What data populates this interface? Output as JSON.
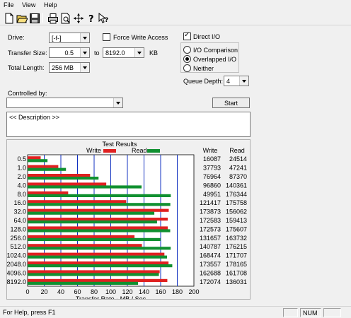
{
  "menu": {
    "file": "File",
    "view": "View",
    "help": "Help"
  },
  "toolbar": {
    "icons": [
      "new-icon",
      "open-icon",
      "save-icon",
      "print-icon",
      "print-preview-icon",
      "move-icon",
      "help-icon",
      "context-help-icon"
    ]
  },
  "drive": {
    "label": "Drive:",
    "value": "[-f-]"
  },
  "transfer_size": {
    "label": "Transfer Size:",
    "from": "0.5",
    "to_label": "to",
    "to": "8192.0",
    "unit": "KB"
  },
  "total_length": {
    "label": "Total Length:",
    "value": "256 MB"
  },
  "force_write": {
    "label": "Force Write Access",
    "checked": false
  },
  "direct_io": {
    "label": "Direct I/O",
    "checked": true
  },
  "io_mode": {
    "options": [
      "I/O Comparison",
      "Overlapped I/O",
      "Neither"
    ],
    "selected": "Overlapped I/O"
  },
  "queue_depth": {
    "label": "Queue Depth:",
    "value": "4"
  },
  "controlled_by": {
    "label": "Controlled by:",
    "value": ""
  },
  "start_button": "Start",
  "description": "<< Description >>",
  "results": {
    "title": "Test Results",
    "write_label": "Write",
    "read_label": "Read",
    "write_color": "#e02020",
    "read_color": "#109030",
    "col_write": "Write",
    "col_read": "Read",
    "axis_title": "Transfer Rate - MB / Sec"
  },
  "chart_data": {
    "type": "bar",
    "orientation": "horizontal",
    "title": "Test Results",
    "xlabel": "Transfer Rate - MB / Sec",
    "xlim": [
      0,
      200
    ],
    "xticks": [
      "0",
      "20",
      "40",
      "60",
      "80",
      "100",
      "120",
      "140",
      "160",
      "180",
      "200"
    ],
    "categories": [
      "0.5",
      "1.0",
      "2.0",
      "4.0",
      "8.0",
      "16.0",
      "32.0",
      "64.0",
      "128.0",
      "256.0",
      "512.0",
      "1024.0",
      "2048.0",
      "4096.0",
      "8192.0"
    ],
    "series": [
      {
        "name": "Write",
        "values": [
          16087,
          37793,
          76964,
          96860,
          49951,
          121417,
          173873,
          172583,
          172573,
          131657,
          140787,
          168474,
          173557,
          162688,
          172074
        ]
      },
      {
        "name": "Read",
        "values": [
          24514,
          47241,
          87370,
          140361,
          176344,
          175758,
          156062,
          159413,
          175607,
          163732,
          176215,
          171707,
          178165,
          161708,
          136031
        ]
      }
    ],
    "legend": "top"
  },
  "status": {
    "help_text": "For Help, press F1",
    "num": "NUM"
  }
}
